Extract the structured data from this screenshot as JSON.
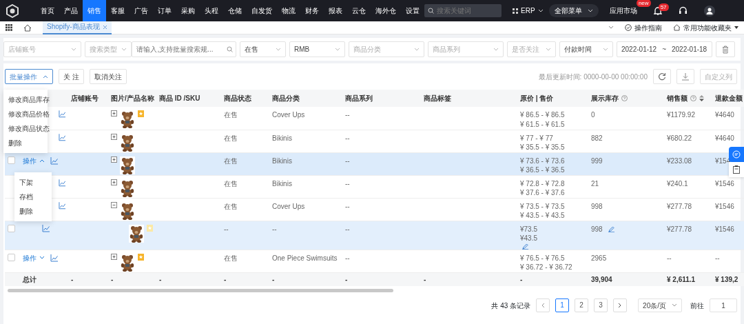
{
  "nav": {
    "items": [
      {
        "label": "首页",
        "selected": false
      },
      {
        "label": "产品",
        "selected": false
      },
      {
        "label": "销售",
        "selected": true
      },
      {
        "label": "客服",
        "selected": false
      },
      {
        "label": "广告",
        "selected": false
      },
      {
        "label": "订单",
        "selected": false
      },
      {
        "label": "采购",
        "selected": false
      },
      {
        "label": "头程",
        "selected": false
      },
      {
        "label": "仓储",
        "selected": false
      },
      {
        "label": "自发货",
        "selected": false
      },
      {
        "label": "物流",
        "selected": false
      },
      {
        "label": "财务",
        "selected": false
      },
      {
        "label": "报表",
        "selected": false
      },
      {
        "label": "云仓",
        "selected": false
      },
      {
        "label": "海外仓",
        "selected": false
      },
      {
        "label": "设置",
        "selected": false
      }
    ],
    "search": {
      "placeholder": "搜索关键词"
    },
    "erp": "ERP",
    "all_menu": "全部菜单",
    "market": {
      "label": "应用市场",
      "badge": "new"
    },
    "bell_badge": "57"
  },
  "tabbar": {
    "tabs": [
      {
        "label": "Shopify-商品表现",
        "selected": true
      }
    ],
    "guide": "操作指南",
    "favorites": "常用功能收藏夹"
  },
  "filters": [
    {
      "kind": "select",
      "placeholder": "店铺账号"
    },
    {
      "kind": "search",
      "type_placeholder": "搜索类型",
      "placeholder": "请输入,支持批量搜索规..."
    },
    {
      "kind": "select",
      "value": "在售"
    },
    {
      "kind": "select",
      "value": "RMB"
    },
    {
      "kind": "select",
      "placeholder": "商品分类"
    },
    {
      "kind": "select",
      "placeholder": "商品系列"
    },
    {
      "kind": "select",
      "placeholder": "是否关注"
    },
    {
      "kind": "select",
      "value": "付款时间"
    },
    {
      "kind": "daterange",
      "start": "2022-01-12",
      "sep": "~",
      "end": "2022-01-18"
    },
    {
      "kind": "delete"
    }
  ],
  "toolbar": {
    "batch": "批量操作",
    "batch_expanded": true,
    "batch_menu": [
      "修改商品库存",
      "修改商品价格",
      "修改商品状态",
      "删除"
    ],
    "follow": "关 注",
    "unfollow": "取消关注",
    "updated": "最后更新时间: 0000-00-00 00:00:00",
    "columns": "自定义列"
  },
  "table": {
    "columns": [
      "店铺账号",
      "图片/产品名称",
      "商品 ID /SKU",
      "商品状态",
      "商品分类",
      "商品系列",
      "商品标签",
      "原价 | 售价",
      "展示库存",
      "销售额",
      "退款金额"
    ],
    "row_menu": [
      "下架",
      "存档",
      "删除"
    ],
    "rows": [
      {
        "kind": "parent",
        "selected": false,
        "expanded": false,
        "flagged": true,
        "status": "在售",
        "category": "Cover Ups",
        "series": "--",
        "prices": [
          "¥ 86.5 - ¥ 86.5",
          "¥ 61.5 - ¥ 61.5"
        ],
        "stock": "0",
        "sales": "¥1179.92",
        "refund": "¥4640"
      },
      {
        "kind": "parent",
        "selected": false,
        "expanded": false,
        "flagged": false,
        "status": "在售",
        "category": "Bikinis",
        "series": "--",
        "prices": [
          "¥ 77 - ¥ 77",
          "¥ 35.5 - ¥ 35.5"
        ],
        "stock": "882",
        "sales": "¥680.22",
        "refund": "¥4640"
      },
      {
        "kind": "parent",
        "selected": true,
        "checkbox": {
          "checked": false
        },
        "action": {
          "label": "操作",
          "expanded": true
        },
        "expanded": false,
        "flagged": false,
        "status": "在售",
        "category": "Bikinis",
        "series": "--",
        "prices": [
          "¥ 73.6 - ¥ 73.6",
          "¥ 36.5 - ¥ 36.5"
        ],
        "stock": "999",
        "sales": "¥233.08",
        "refund": "¥154"
      },
      {
        "kind": "parent",
        "selected": false,
        "expanded": false,
        "flagged": false,
        "status": "在售",
        "category": "Bikinis",
        "series": "--",
        "prices": [
          "¥ 72.8 - ¥ 72.8",
          "¥ 37.6 - ¥ 37.6"
        ],
        "stock": "21",
        "sales": "¥240.1",
        "refund": "¥1546"
      },
      {
        "kind": "parent",
        "selected": false,
        "expanded": true,
        "flagged": false,
        "status": "在售",
        "category": "Cover Ups",
        "series": "--",
        "prices": [
          "¥ 73.5 - ¥ 73.5",
          "¥ 43.5 - ¥ 43.5"
        ],
        "stock": "998",
        "sales": "¥277.78",
        "refund": "¥1546"
      },
      {
        "kind": "variant",
        "selected": true,
        "checkbox": {
          "checked": false
        },
        "flagged": true,
        "status": "--",
        "category": "--",
        "series": "--",
        "prices": [
          "¥73.5",
          "¥43.5"
        ],
        "stock": "998",
        "sales": "¥277.78",
        "refund": "¥1546"
      },
      {
        "kind": "parent",
        "selected": false,
        "checkbox": {
          "checked": false
        },
        "action": {
          "label": "操作",
          "expanded": false
        },
        "expanded": false,
        "flagged": true,
        "status": "在售",
        "category": "One Piece Swimsuits",
        "series": "--",
        "prices": [
          "¥ 76.5 - ¥ 76.5",
          "¥ 36.72 - ¥ 36.72"
        ],
        "stock": "2965",
        "sales": "--",
        "refund": "--"
      }
    ],
    "totals": [
      "总计",
      "-",
      "-",
      "-",
      "-",
      "-",
      "-",
      "-",
      "-",
      "39,904",
      "¥ 2,611.1",
      "¥ 139,2"
    ]
  },
  "pagination": {
    "total": "共 43 条记录",
    "pages": [
      {
        "label": "1",
        "selected": true
      },
      {
        "label": "2",
        "selected": false
      },
      {
        "label": "3",
        "selected": false
      }
    ],
    "page_size": "20条/页",
    "goto": "前往",
    "goto_value": "1"
  }
}
